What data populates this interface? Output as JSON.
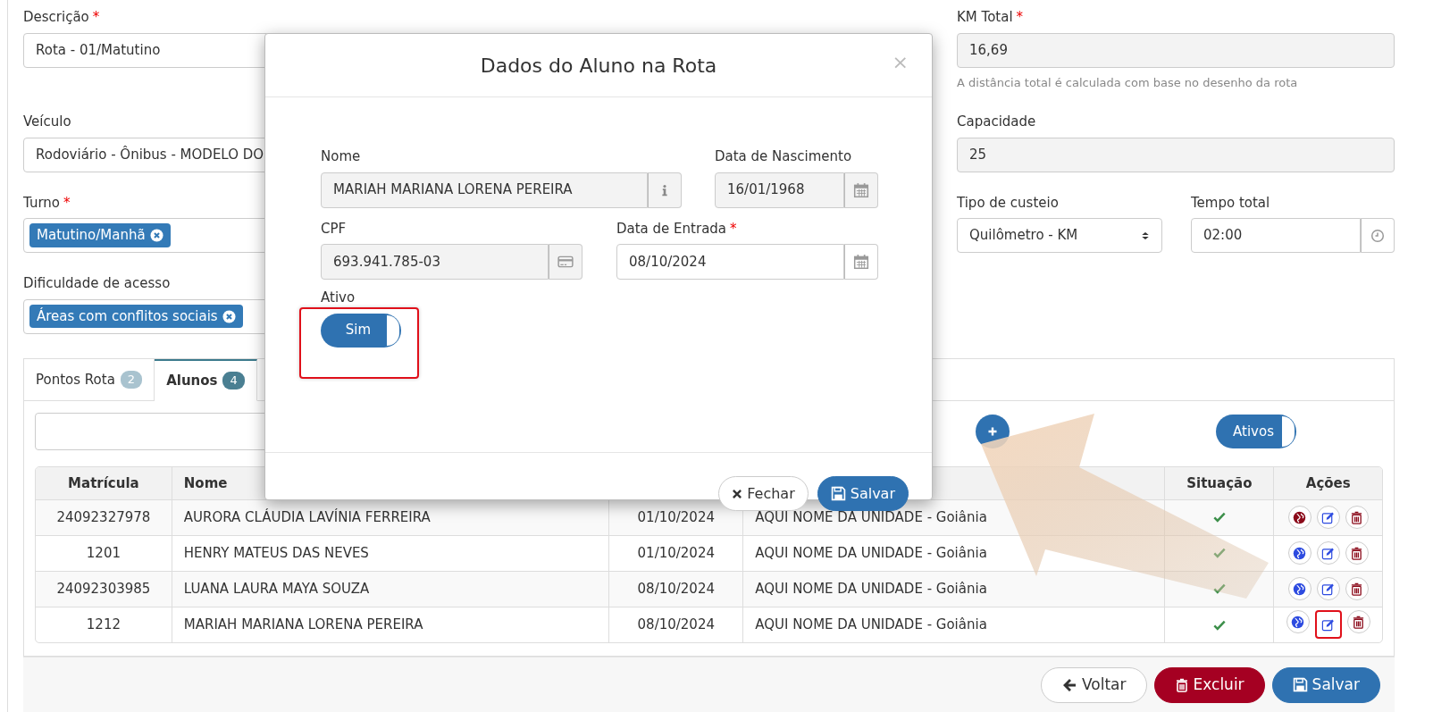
{
  "descricao": {
    "label": "Descrição",
    "required_mark": "*",
    "value": "Rota - 01/Matutino"
  },
  "km_total": {
    "label": "KM Total",
    "required_mark": "*",
    "readonly": true,
    "value": "16,69",
    "help": "A distância total é calculada com base no desenho da rota"
  },
  "veiculo": {
    "label": "Veículo",
    "value": "Rodoviário - Ônibus - MODELO DO"
  },
  "capacidade": {
    "label": "Capacidade",
    "readonly": true,
    "value": "25"
  },
  "turno": {
    "label": "Turno",
    "required_mark": "*",
    "tags": [
      "Matutino/Manhã"
    ]
  },
  "tipo_custeio": {
    "label": "Tipo de custeio",
    "value": "Quilômetro - KM"
  },
  "tempo_total": {
    "label": "Tempo total",
    "value": "02:00"
  },
  "dificuldade": {
    "label": "Dificuldade de acesso",
    "tags": [
      "Áreas com conflitos sociais"
    ]
  },
  "tabs": [
    {
      "label": "Pontos Rota",
      "count": "2",
      "selected": false
    },
    {
      "label": "Alunos",
      "count": "4",
      "selected": true
    }
  ],
  "filter_toggle": {
    "label": "Ativos",
    "on": true
  },
  "table": {
    "headers": {
      "matricula": "Matrícula",
      "nome": "Nome",
      "situacao": "Situação",
      "acoes": "Ações"
    },
    "rows": [
      {
        "matricula": "24092327978",
        "nome": "AURORA CLÁUDIA LAVÍNIA FERREIRA",
        "data": "01/10/2024",
        "unidade": "AQUI NOME DA UNIDADE - Goiânia",
        "active": true,
        "color": "#8b0a1a",
        "highlighted": false
      },
      {
        "matricula": "1201",
        "nome": "HENRY MATEUS DAS NEVES",
        "data": "01/10/2024",
        "unidade": "AQUI NOME DA UNIDADE - Goiânia",
        "active": true,
        "color": "#2d4be0",
        "highlighted": false
      },
      {
        "matricula": "24092303985",
        "nome": "LUANA LAURA MAYA SOUZA",
        "data": "08/10/2024",
        "unidade": "AQUI NOME DA UNIDADE - Goiânia",
        "active": true,
        "color": "#2d4be0",
        "highlighted": false
      },
      {
        "matricula": "1212",
        "nome": "MARIAH MARIANA LORENA PEREIRA",
        "data": "08/10/2024",
        "unidade": "AQUI NOME DA UNIDADE - Goiânia",
        "active": true,
        "color": "#2d4be0",
        "highlighted": true
      }
    ]
  },
  "footer_buttons": [
    {
      "kind": "back",
      "label": "Voltar"
    },
    {
      "kind": "delete",
      "label": "Excluir"
    },
    {
      "kind": "save",
      "label": "Salvar"
    }
  ],
  "modal": {
    "title": "Dados do Aluno na Rota",
    "close": "×",
    "fields": [
      {
        "label": "Nome",
        "readonly": true,
        "value": "MARIAH MARIANA LORENA PEREIRA",
        "kind": "info"
      },
      {
        "label": "Data de Nascimento",
        "readonly": true,
        "value": "16/01/1968",
        "kind": "date"
      },
      {
        "label": "CPF",
        "readonly": true,
        "value": "693.941.785-03",
        "kind": "card"
      },
      {
        "label": "Data de Entrada",
        "required_mark": "*",
        "readonly": false,
        "value": "08/10/2024",
        "kind": "date"
      }
    ],
    "ativo": {
      "label": "Ativo",
      "on": true,
      "text": "Sim",
      "highlighted": true
    },
    "buttons": [
      {
        "kind": "close",
        "label": "Fechar"
      },
      {
        "kind": "save",
        "label": "Salvar"
      }
    ]
  }
}
